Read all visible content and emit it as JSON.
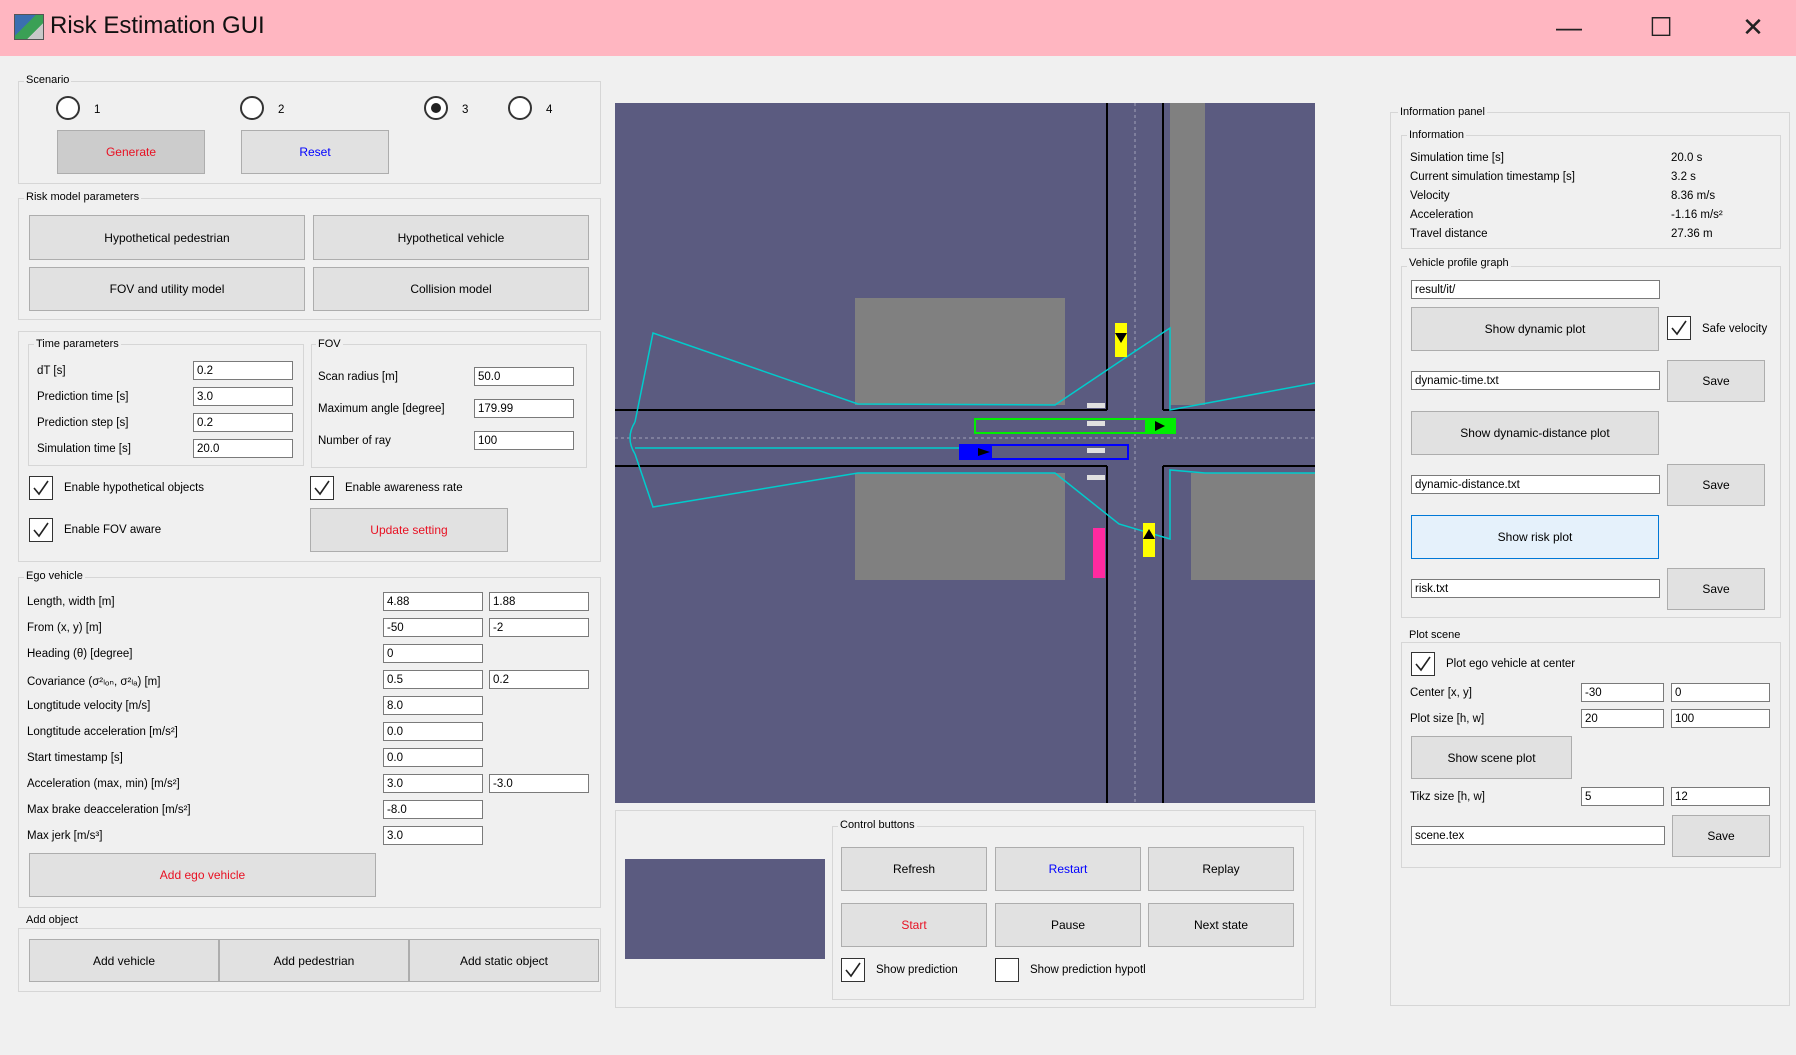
{
  "window": {
    "title": "Risk Estimation GUI",
    "minimize": "—",
    "maximize": "☐",
    "close": "✕"
  },
  "scenario": {
    "title": "Scenario",
    "options": [
      "1",
      "2",
      "3",
      "4"
    ],
    "selected": "3",
    "generate": "Generate",
    "reset": "Reset"
  },
  "risk_model": {
    "title": "Risk model parameters",
    "hyp_ped": "Hypothetical pedestrian",
    "hyp_veh": "Hypothetical vehicle",
    "fov_utility": "FOV and utility model",
    "collision": "Collision model"
  },
  "time_params": {
    "title": "Time parameters",
    "dt_label": "dT [s]",
    "dt": "0.2",
    "pred_time_label": "Prediction time [s]",
    "pred_time": "3.0",
    "pred_step_label": "Prediction step [s]",
    "pred_step": "0.2",
    "sim_time_label": "Simulation time [s]",
    "sim_time": "20.0"
  },
  "fov": {
    "title": "FOV",
    "scan_label": "Scan radius [m]",
    "scan": "50.0",
    "angle_label": "Maximum angle [degree]",
    "angle": "179.99",
    "rays_label": "Number of ray",
    "rays": "100"
  },
  "options": {
    "hyp_objects": "Enable hypothetical objects",
    "awareness": "Enable awareness rate",
    "fov_aware": "Enable FOV aware",
    "update": "Update setting"
  },
  "ego": {
    "title": "Ego vehicle",
    "length_width_label": "Length, width [m]",
    "length": "4.88",
    "width": "1.88",
    "from_label": "From (x, y) [m]",
    "from_x": "-50",
    "from_y": "-2",
    "heading_label": "Heading (θ) [degree]",
    "heading": "0",
    "cov_label": "Covariance (σ²ₗₒₙ, σ²ₗₐ) [m]",
    "cov_lon": "0.5",
    "cov_lat": "0.2",
    "lon_vel_label": "Longtitude velocity [m/s]",
    "lon_vel": "8.0",
    "lon_acc_label": "Longtitude acceleration [m/s²]",
    "lon_acc": "0.0",
    "start_label": "Start timestamp [s]",
    "start": "0.0",
    "acc_label": "Acceleration (max, min) [m/s²]",
    "acc_max": "3.0",
    "acc_min": "-3.0",
    "brake_label": "Max brake deacceleration [m/s²]",
    "brake": "-8.0",
    "jerk_label": "Max jerk [m/s³]",
    "jerk": "3.0",
    "add": "Add ego vehicle"
  },
  "add_object": {
    "title": "Add object",
    "vehicle": "Add vehicle",
    "pedestrian": "Add pedestrian",
    "static": "Add static object"
  },
  "control": {
    "title": "Control buttons",
    "refresh": "Refresh",
    "restart": "Restart",
    "replay": "Replay",
    "start": "Start",
    "pause": "Pause",
    "next": "Next state",
    "show_pred": "Show prediction",
    "show_pred_hyp": "Show prediction hypotl"
  },
  "info": {
    "title": "Information panel",
    "sub": "Information",
    "rows": [
      {
        "label": "Simulation time [s]",
        "value": "20.0 s"
      },
      {
        "label": "Current simulation timestamp [s]",
        "value": "3.2 s"
      },
      {
        "label": "Velocity",
        "value": "8.36 m/s"
      },
      {
        "label": "Acceleration",
        "value": "-1.16 m/s²"
      },
      {
        "label": "Travel distance",
        "value": "27.36 m"
      }
    ]
  },
  "profile": {
    "title": "Vehicle profile graph",
    "path": "result/it/",
    "dyn_plot": "Show dynamic plot",
    "safe_velocity": "Safe velocity",
    "dyn_file": "dynamic-time.txt",
    "save": "Save",
    "dist_plot": "Show dynamic-distance plot",
    "dist_file": "dynamic-distance.txt",
    "risk_plot": "Show risk plot",
    "risk_file": "risk.txt"
  },
  "plot_scene": {
    "title": "Plot scene",
    "ego_center": "Plot ego vehicle at center",
    "center_label": "Center [x, y]",
    "center_x": "-30",
    "center_y": "0",
    "size_label": "Plot size [h, w]",
    "size_h": "20",
    "size_w": "100",
    "show": "Show scene plot",
    "tikz_label": "Tikz size [h, w]",
    "tikz_h": "5",
    "tikz_w": "12",
    "file": "scene.tex",
    "save": "Save"
  },
  "colors": {
    "titlebar": "#ffb6c1",
    "canvas": "#5b5b80",
    "road_line": "#000000",
    "fov": "#00cccc",
    "ego": "#0000ff",
    "other": "#00ee00",
    "pedestrian": "#ffff00",
    "obstacle": "#808080"
  }
}
